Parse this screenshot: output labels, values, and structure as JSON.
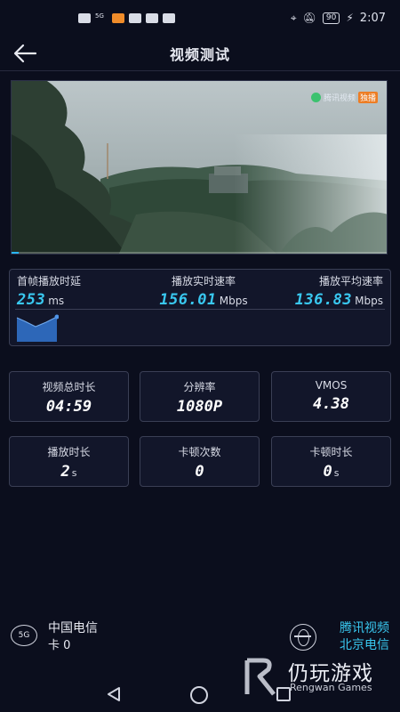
{
  "status_bar": {
    "time": "2:07",
    "battery": "90",
    "network_label": "5G"
  },
  "header": {
    "title": "视频测试",
    "back_icon": "arrow-left-icon"
  },
  "video": {
    "watermark_text": "腾讯视频",
    "watermark_tag": "独播",
    "progress": 0.02
  },
  "metrics": {
    "first_frame": {
      "label": "首帧播放时延",
      "value": "253",
      "unit": "ms"
    },
    "realtime_rate": {
      "label": "播放实时速率",
      "value": "156.01",
      "unit": "Mbps"
    },
    "avg_rate": {
      "label": "播放平均速率",
      "value": "136.83",
      "unit": "Mbps"
    }
  },
  "cards": {
    "total_duration": {
      "label": "视频总时长",
      "value": "04:59"
    },
    "resolution": {
      "label": "分辨率",
      "value": "1080P"
    },
    "vmos": {
      "label": "VMOS",
      "value": "4.38"
    },
    "play_duration": {
      "label": "播放时长",
      "value": "2",
      "unit": "s"
    },
    "stall_count": {
      "label": "卡顿次数",
      "value": "0"
    },
    "stall_duration": {
      "label": "卡顿时长",
      "value": "0",
      "unit": "s"
    }
  },
  "footer": {
    "network_badge": "5G",
    "carrier_name": "中国电信",
    "sim_slot": "卡 0",
    "server_name": "腾讯视频",
    "server_location": "北京电信"
  },
  "brand": {
    "name": "仍玩游戏",
    "english": "Rengwan Games"
  },
  "colors": {
    "background": "#0b0e1d",
    "accent": "#39c8f0",
    "panel_border": "#3a3f55"
  }
}
